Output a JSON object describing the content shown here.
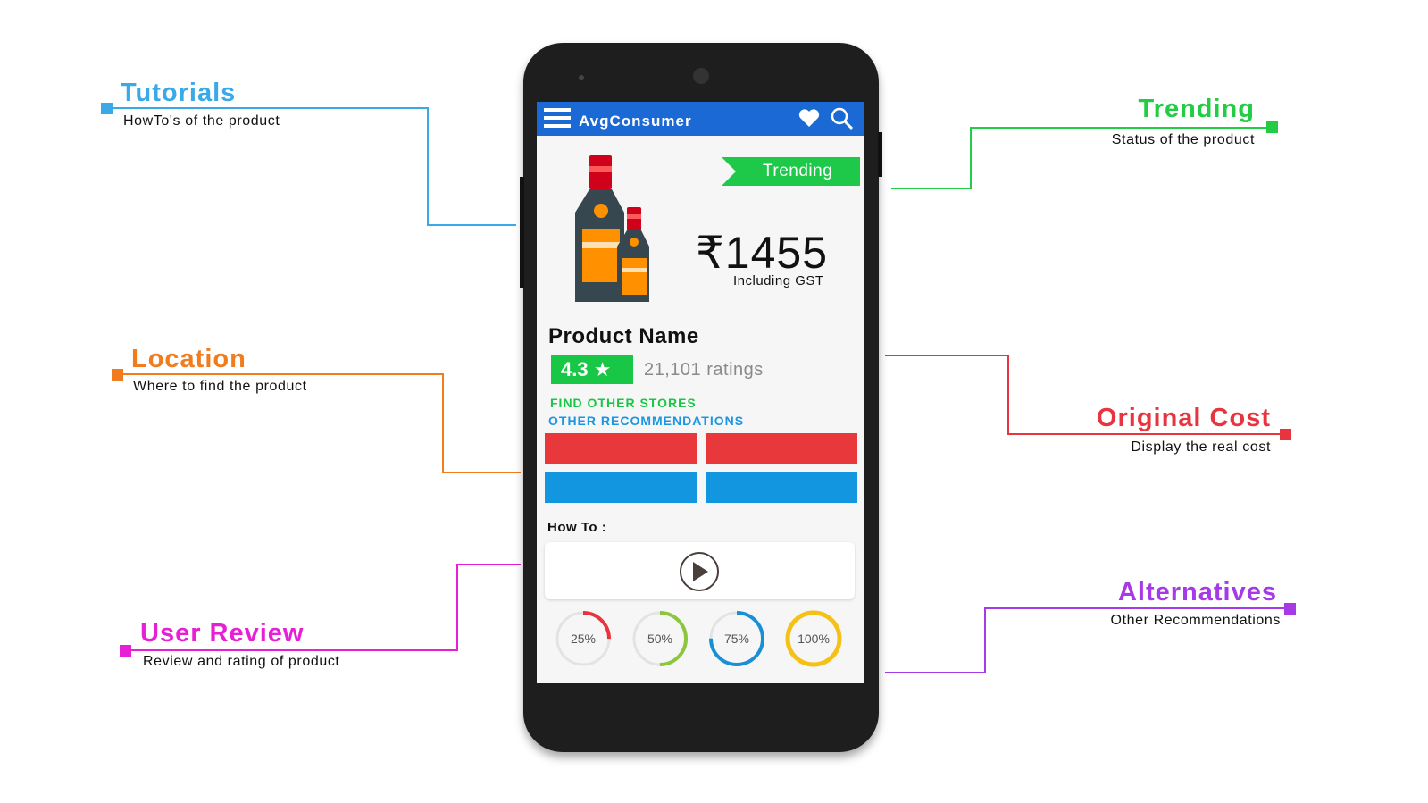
{
  "callouts": {
    "tutorials": {
      "title": "Tutorials",
      "subtitle": "HowTo's of the product",
      "color": "#3aa9e8"
    },
    "location": {
      "title": "Location",
      "subtitle": "Where to find the product",
      "color": "#f07c1e"
    },
    "user_review": {
      "title": "User Review",
      "subtitle": "Review and rating of product",
      "color": "#e620d6"
    },
    "trending": {
      "title": "Trending",
      "subtitle": "Status of the product",
      "color": "#22cc44"
    },
    "original_cost": {
      "title": "Original Cost",
      "subtitle": "Display the real cost",
      "color": "#e8343f"
    },
    "alternatives": {
      "title": "Alternatives",
      "subtitle": "Other Recommendations",
      "color": "#a63ae6"
    }
  },
  "app": {
    "title": "AvgConsumer",
    "icons": [
      "menu-icon",
      "heart-icon",
      "search-icon"
    ],
    "badge": "Trending",
    "price": "₹1455",
    "price_note": "Including GST",
    "product_name": "Product Name",
    "rating": "4.3 ★",
    "rating_count": "21,101 ratings",
    "find_stores": "FIND OTHER STORES",
    "other_recommendations": "OTHER RECOMMENDATIONS",
    "howto_label": "How To :",
    "progress": [
      {
        "label": "25%",
        "value": 25,
        "color": "#e8343f"
      },
      {
        "label": "50%",
        "value": 50,
        "color": "#8cc63f"
      },
      {
        "label": "75%",
        "value": 75,
        "color": "#1b8fd6"
      },
      {
        "label": "100%",
        "value": 100,
        "color": "#f5c118"
      }
    ]
  }
}
